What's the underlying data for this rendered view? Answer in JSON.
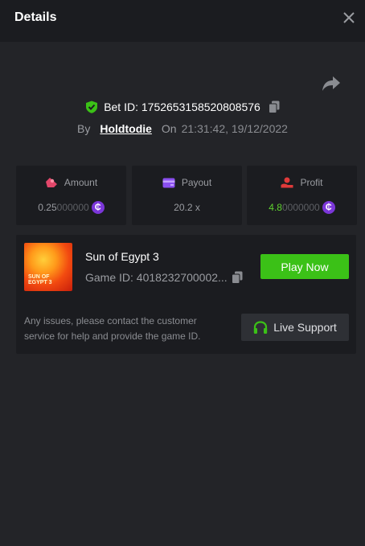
{
  "header": {
    "title": "Details"
  },
  "bet": {
    "id_label": "Bet ID: 1752653158520808576",
    "by_label": "By",
    "user": "Holdtodie",
    "on_label": "On",
    "time": "21:31:42, 19/12/2022"
  },
  "stats": {
    "amount": {
      "label": "Amount",
      "value_main": "0.25",
      "value_dim": "000000"
    },
    "payout": {
      "label": "Payout",
      "value": "20.2 x"
    },
    "profit": {
      "label": "Profit",
      "value_main": "4.8",
      "value_dim": "0000000"
    }
  },
  "game": {
    "thumb_text_1": "SUN OF",
    "thumb_text_2": "EGYPT 3",
    "name": "Sun of Egypt 3",
    "id_label": "Game ID: 4018232700002...",
    "play_label": "Play Now",
    "notice": "Any issues, please contact the customer service for help and provide the game ID.",
    "support_label": "Live Support"
  },
  "colors": {
    "background": "#232428",
    "card": "#1b1c20",
    "accent_green": "#3bc117",
    "profit_green": "#5fd12f",
    "coin_purple": "#7b36d9",
    "amount_icon": "#e2476a",
    "payout_icon": "#8b4ff0",
    "profit_icon": "#e03a3a"
  },
  "icons": [
    "close-icon",
    "share-icon",
    "shield-check-icon",
    "copy-icon",
    "amount-icon",
    "wallet-icon",
    "profit-icon",
    "coin-icon",
    "headset-icon"
  ]
}
